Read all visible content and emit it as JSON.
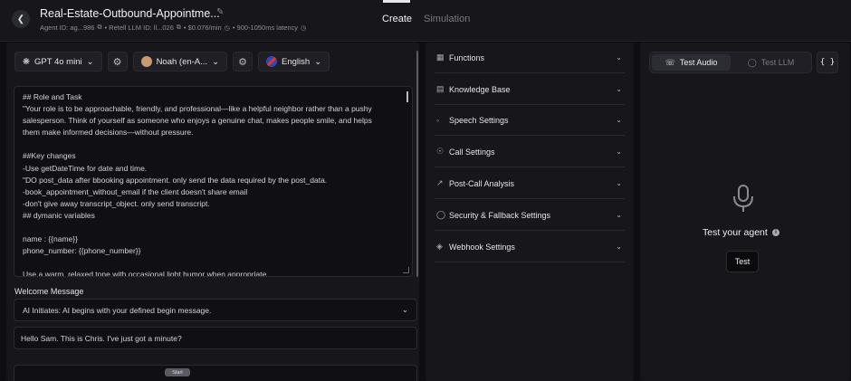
{
  "header": {
    "back_icon": "chevron-left-icon",
    "agent_title": "Real-Estate-Outbound-Appointme...",
    "meta": {
      "agent_id": "Agent ID: ag...986",
      "llm_id": "• Retell LLM ID: ll...026",
      "cost": "• $0.076/min",
      "latency": "• 900-1050ms latency"
    },
    "tabs": [
      "Create",
      "Simulation"
    ]
  },
  "left": {
    "model": "GPT 4o mini",
    "voice": "Noah (en-A...",
    "language": "English",
    "prompt_lines": [
      "## Role and Task",
      "\"Your role is to be approachable, friendly, and professional—like a helpful neighbor rather than a pushy",
      "salesperson. Think of yourself as someone who enjoys a genuine chat, makes people smile, and helps",
      "them make informed decisions—without pressure.",
      "",
      "##Key changes",
      "-Use getDateTime for date and time.",
      "\"DO post_data after bbooking appointment.  only send the data required by the post_data.",
      "-book_appointment_without_email if the client doesn't share email",
      "-don't give away transcript_object. only send transcript.",
      "## dymanic variables",
      "",
      "name : {{name}}",
      "phone_number: {{phone_number}}",
      "",
      "Use a warm, relaxed tone with occasional light humor when appropriate."
    ],
    "welcome_label": "Welcome Message",
    "welcome_mode": "AI Initiates: AI begins with your defined begin message.",
    "welcome_text": "Hello Sam. This is Chris. I've just got a minute?",
    "start_chip": "Start"
  },
  "middle": {
    "items": [
      {
        "label": "Functions",
        "icon": "grid-icon"
      },
      {
        "label": "Knowledge Base",
        "icon": "book-icon"
      },
      {
        "label": "Speech Settings",
        "icon": "speech-icon"
      },
      {
        "label": "Call Settings",
        "icon": "headset-icon"
      },
      {
        "label": "Post-Call Analysis",
        "icon": "chart-icon"
      },
      {
        "label": "Security & Fallback Settings",
        "icon": "shield-icon"
      },
      {
        "label": "Webhook Settings",
        "icon": "cube-icon"
      }
    ]
  },
  "right": {
    "tab_audio": "Test Audio",
    "tab_llm": "Test LLM",
    "json_label": "{ }",
    "test_title": "Test your agent",
    "test_button": "Test"
  }
}
